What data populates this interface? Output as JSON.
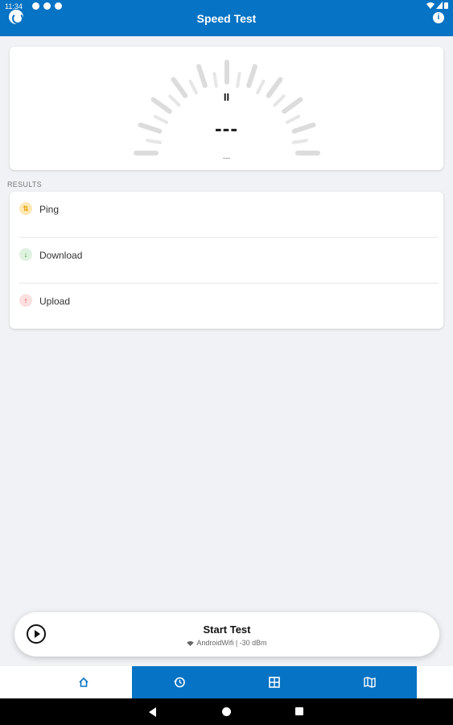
{
  "status_bar": {
    "time": "11:34",
    "signal_icons": [
      "wifi-icon",
      "signal-icon",
      "battery-icon"
    ]
  },
  "app_bar": {
    "title": "Speed Test",
    "logo_icon": "speed-test-logo-icon",
    "info_icon": "info-icon",
    "color": "#0673c4"
  },
  "gauge": {
    "control_icon": "pause-icon",
    "control_symbol": "II",
    "value": "---",
    "unit": "---"
  },
  "results": {
    "header": "RESULTS",
    "items": [
      {
        "label": "Ping",
        "icon": "ping-icon",
        "symbol": "⇅",
        "color": "#e5a100"
      },
      {
        "label": "Download",
        "icon": "download-arrow-icon",
        "symbol": "↓",
        "color": "#2f9a2f"
      },
      {
        "label": "Upload",
        "icon": "upload-arrow-icon",
        "symbol": "↑",
        "color": "#d82626"
      }
    ]
  },
  "start_button": {
    "label": "Start Test",
    "icon": "play-icon",
    "network": "AndroidWifi | -30 dBm"
  },
  "bottom_nav": {
    "items": [
      {
        "name": "home",
        "icon": "home-icon",
        "active": true
      },
      {
        "name": "history",
        "icon": "history-icon",
        "active": false
      },
      {
        "name": "dashboard",
        "icon": "dashboard-icon",
        "active": false
      },
      {
        "name": "map",
        "icon": "map-icon",
        "active": false
      }
    ]
  },
  "system_nav": {
    "buttons": [
      "back-icon",
      "home-circle-icon",
      "recents-icon"
    ]
  }
}
